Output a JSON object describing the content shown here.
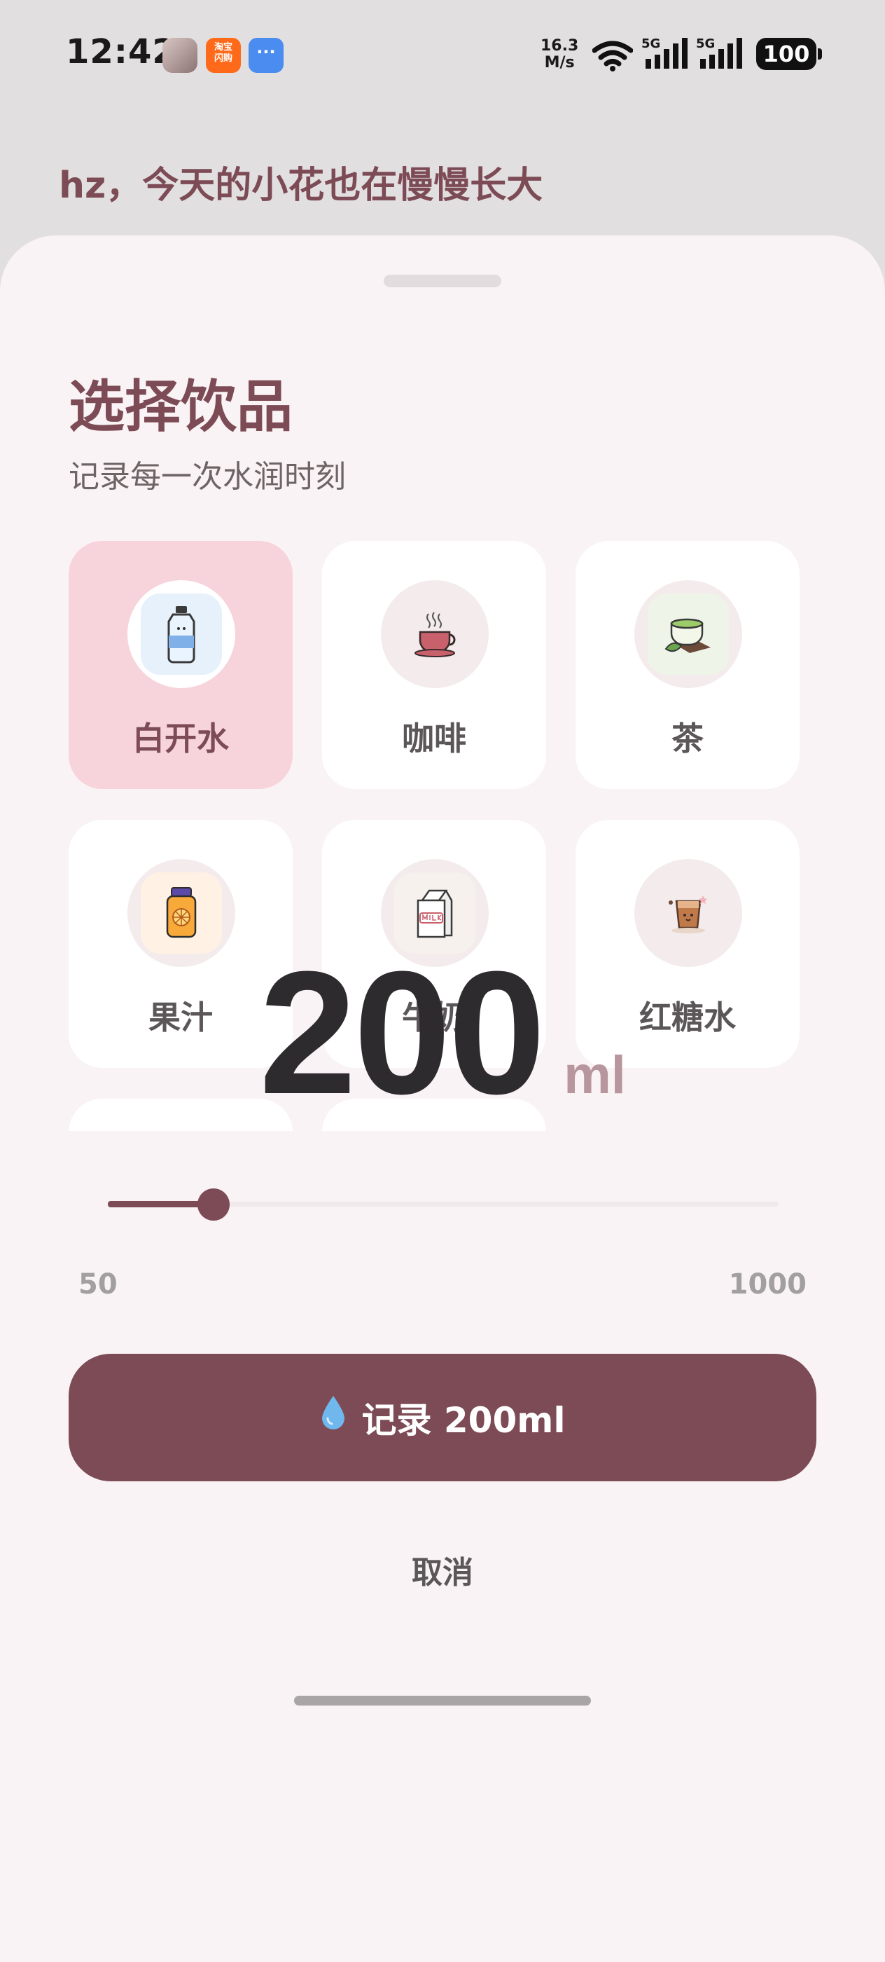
{
  "status_bar": {
    "time": "12:42",
    "net_speed_value": "16.3",
    "net_speed_unit": "M/s",
    "sim1_label": "5G",
    "sim2_label": "5G",
    "battery": "100",
    "taobao_app_text": "淘宝闪购"
  },
  "greeting": "hz，今天的小花也在慢慢长大",
  "sheet": {
    "title": "选择饮品",
    "subtitle": "记录每一次水润时刻",
    "drinks": [
      {
        "label": "白开水",
        "icon": "water-bottle-icon",
        "selected": true
      },
      {
        "label": "咖啡",
        "icon": "coffee-cup-icon",
        "selected": false
      },
      {
        "label": "茶",
        "icon": "tea-cup-icon",
        "selected": false
      },
      {
        "label": "果汁",
        "icon": "juice-jar-icon",
        "selected": false
      },
      {
        "label": "牛奶",
        "icon": "milk-carton-icon",
        "selected": false
      },
      {
        "label": "红糖水",
        "icon": "brown-sugar-drink-icon",
        "selected": false
      }
    ],
    "amount": {
      "value": "200",
      "unit": "ml"
    },
    "slider": {
      "min": "50",
      "max": "1000",
      "value": 200
    },
    "record_button_label": "记录 200ml",
    "record_button_icon": "water-drop-icon",
    "cancel_label": "取消"
  },
  "colors": {
    "accent": "#7c4b55",
    "selected_card": "#f7d4db",
    "sheet_bg": "#faf3f5"
  }
}
